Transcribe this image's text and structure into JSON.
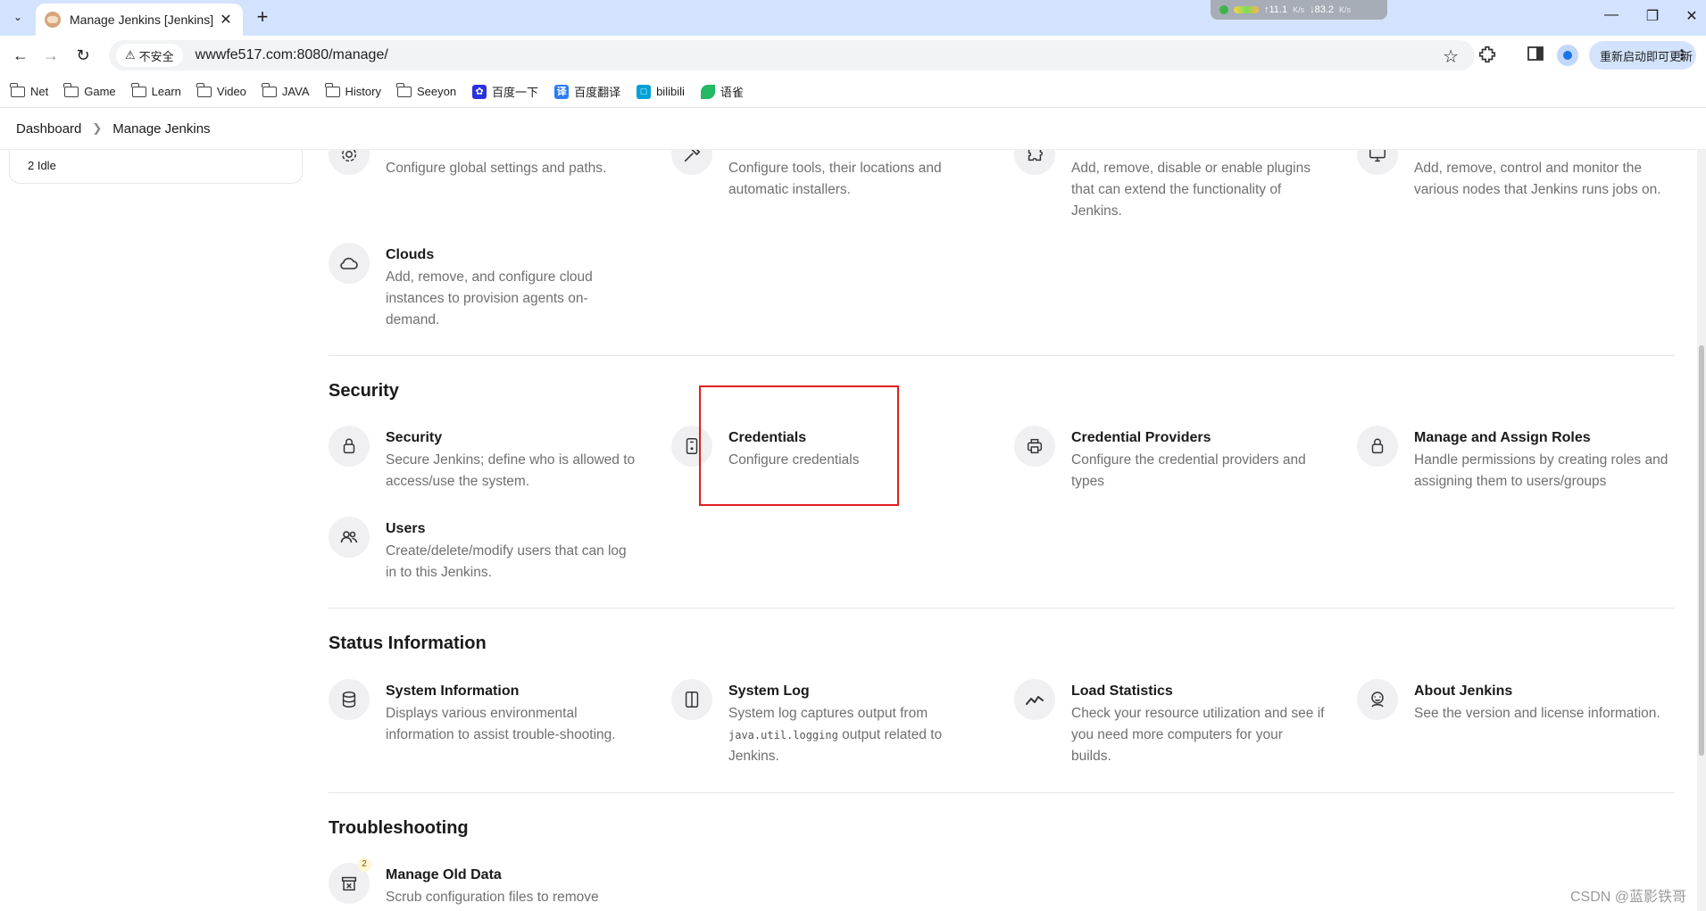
{
  "browser": {
    "tab": {
      "title": "Manage Jenkins [Jenkins]"
    },
    "network_monitor": {
      "up": "↑11.1",
      "up_unit": "K/s",
      "down": "↓83.2",
      "down_unit": "K/s"
    },
    "address_bar": {
      "security_label": "不安全",
      "url": "wwwfe517.com:8080/manage/"
    },
    "update_button": "重新启动即可更新"
  },
  "bookmarks": [
    {
      "label": "Net",
      "icon": "folder-icon"
    },
    {
      "label": "Game",
      "icon": "folder-icon"
    },
    {
      "label": "Learn",
      "icon": "folder-icon"
    },
    {
      "label": "Video",
      "icon": "folder-icon"
    },
    {
      "label": "JAVA",
      "icon": "folder-icon"
    },
    {
      "label": "History",
      "icon": "folder-icon"
    },
    {
      "label": "Seeyon",
      "icon": "folder-icon"
    },
    {
      "label": "百度一下",
      "icon": "baidu-icon",
      "color": "#2932e1"
    },
    {
      "label": "百度翻译",
      "icon": "baidu-translate-icon",
      "color": "#2c7cf6"
    },
    {
      "label": "bilibili",
      "icon": "bilibili-icon",
      "color": "#00a1d6"
    },
    {
      "label": "语雀",
      "icon": "yuque-icon",
      "color": "#25b864"
    }
  ],
  "breadcrumb": {
    "home": "Dashboard",
    "current": "Manage Jenkins"
  },
  "side_panel": {
    "executor": "2  Idle"
  },
  "system_config": {
    "items": [
      {
        "name": "",
        "desc": "Configure global settings and paths.",
        "icon": "gear-icon"
      },
      {
        "name": "",
        "desc": "Configure tools, their locations and automatic installers.",
        "icon": "hammer-icon"
      },
      {
        "name": "",
        "desc": "Add, remove, disable or enable plugins that can extend the functionality of Jenkins.",
        "icon": "puzzle-icon"
      },
      {
        "name": "",
        "desc": "Add, remove, control and monitor the various nodes that Jenkins runs jobs on.",
        "icon": "monitor-icon"
      },
      {
        "name": "Clouds",
        "desc": "Add, remove, and configure cloud instances to provision agents on-demand.",
        "icon": "cloud-icon"
      }
    ]
  },
  "security": {
    "title": "Security",
    "items": [
      {
        "name": "Security",
        "desc": "Secure Jenkins; define who is allowed to access/use the system.",
        "icon": "lock-icon"
      },
      {
        "name": "Credentials",
        "desc": "Configure credentials",
        "icon": "credentials-icon"
      },
      {
        "name": "Credential Providers",
        "desc": "Configure the credential providers and types",
        "icon": "printer-icon"
      },
      {
        "name": "Manage and Assign Roles",
        "desc": "Handle permissions by creating roles and assigning them to users/groups",
        "icon": "lock-icon"
      },
      {
        "name": "Users",
        "desc": "Create/delete/modify users that can log in to this Jenkins.",
        "icon": "users-icon"
      }
    ]
  },
  "status_info": {
    "title": "Status Information",
    "items": [
      {
        "name": "System Information",
        "desc": "Displays various environmental information to assist trouble-shooting.",
        "icon": "database-icon"
      },
      {
        "name": "System Log",
        "desc_pre": "System log captures output from ",
        "desc_code": "java.util.logging",
        "desc_post": " output related to Jenkins.",
        "icon": "log-icon"
      },
      {
        "name": "Load Statistics",
        "desc": "Check your resource utilization and see if you need more computers for your builds.",
        "icon": "trend-icon"
      },
      {
        "name": "About Jenkins",
        "desc": "See the version and license information.",
        "icon": "jenkins-icon"
      }
    ]
  },
  "troubleshooting": {
    "title": "Troubleshooting",
    "items": [
      {
        "name": "Manage Old Data",
        "desc": "Scrub configuration files to remove",
        "icon": "archive-icon",
        "badge": "2"
      }
    ]
  },
  "watermark": "CSDN @蓝影铁哥",
  "colors": {
    "tabstrip": "#d3e3fd",
    "highlight": "#e02020",
    "icon_bg": "#f0f0f2",
    "desc_text": "#707070"
  }
}
